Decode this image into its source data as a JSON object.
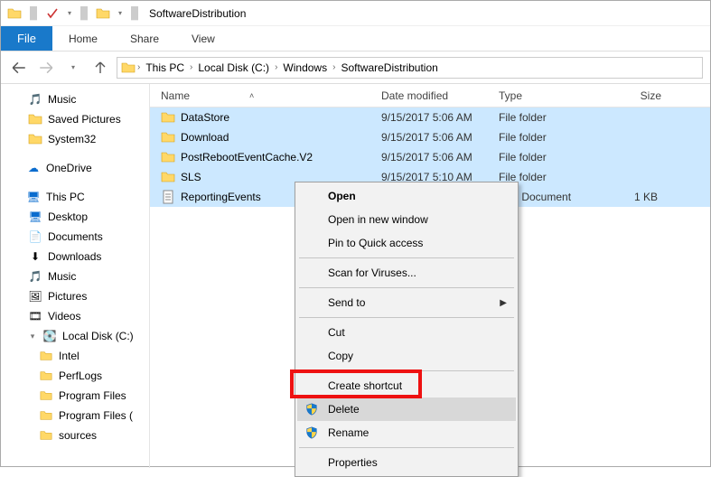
{
  "title": "SoftwareDistribution",
  "ribbon": {
    "file": "File",
    "tabs": [
      "Home",
      "Share",
      "View"
    ]
  },
  "breadcrumbs": [
    "This PC",
    "Local Disk (C:)",
    "Windows",
    "SoftwareDistribution"
  ],
  "sidebar": {
    "quick": [
      {
        "label": "Music",
        "icon": "music"
      },
      {
        "label": "Saved Pictures",
        "icon": "folder"
      },
      {
        "label": "System32",
        "icon": "folder"
      }
    ],
    "onedrive": {
      "label": "OneDrive",
      "icon": "cloud"
    },
    "thispc": {
      "label": "This PC",
      "children": [
        {
          "label": "Desktop",
          "icon": "desktop"
        },
        {
          "label": "Documents",
          "icon": "doc"
        },
        {
          "label": "Downloads",
          "icon": "download"
        },
        {
          "label": "Music",
          "icon": "music"
        },
        {
          "label": "Pictures",
          "icon": "pictures"
        },
        {
          "label": "Videos",
          "icon": "video"
        }
      ],
      "drive": {
        "label": "Local Disk (C:)",
        "children": [
          "Intel",
          "PerfLogs",
          "Program Files",
          "Program Files (",
          "sources"
        ]
      }
    }
  },
  "columns": {
    "name": "Name",
    "date": "Date modified",
    "type": "Type",
    "size": "Size"
  },
  "files": [
    {
      "name": "DataStore",
      "date": "9/15/2017 5:06 AM",
      "type": "File folder",
      "size": "",
      "icon": "folder"
    },
    {
      "name": "Download",
      "date": "9/15/2017 5:06 AM",
      "type": "File folder",
      "size": "",
      "icon": "folder"
    },
    {
      "name": "PostRebootEventCache.V2",
      "date": "9/15/2017 5:06 AM",
      "type": "File folder",
      "size": "",
      "icon": "folder"
    },
    {
      "name": "SLS",
      "date": "9/15/2017 5:10 AM",
      "type": "File folder",
      "size": "",
      "icon": "folder"
    },
    {
      "name": "ReportingEvents",
      "date": "",
      "type": "Text Document",
      "size": "1 KB",
      "icon": "file"
    }
  ],
  "context_menu": {
    "open": "Open",
    "open_new": "Open in new window",
    "pin": "Pin to Quick access",
    "scan": "Scan for Viruses...",
    "sendto": "Send to",
    "cut": "Cut",
    "copy": "Copy",
    "shortcut": "Create shortcut",
    "delete": "Delete",
    "rename": "Rename",
    "properties": "Properties"
  }
}
